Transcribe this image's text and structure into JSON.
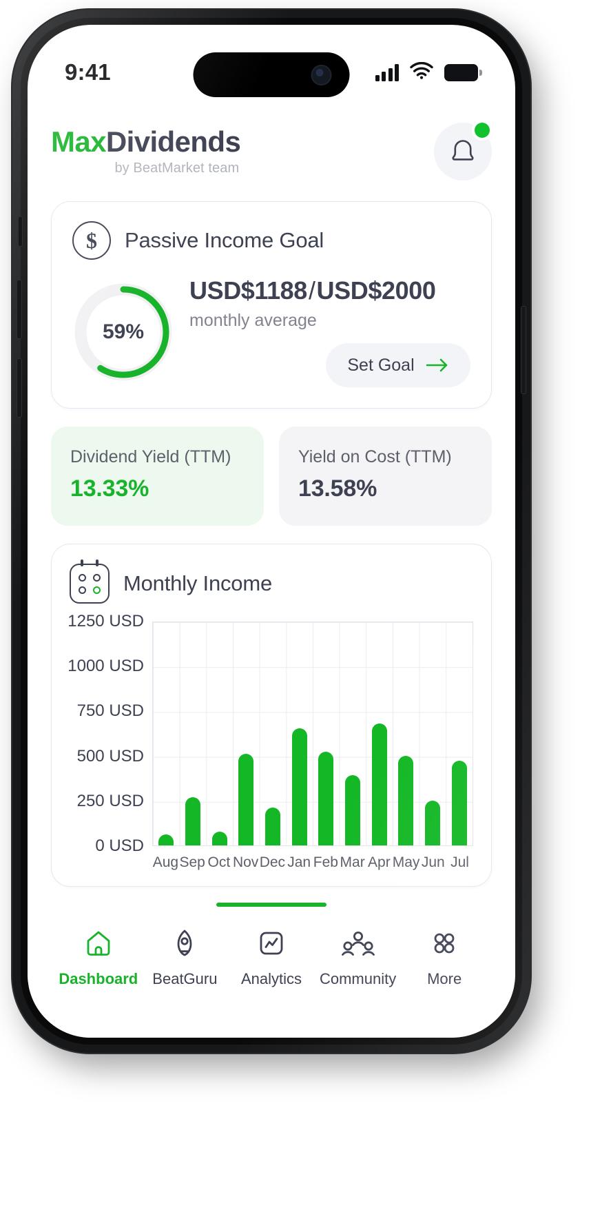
{
  "status_bar": {
    "time": "9:41",
    "signal_icon": "cellular-signal-icon",
    "wifi_icon": "wifi-icon",
    "battery_icon": "battery-icon"
  },
  "app_bar": {
    "brand_first": "Max",
    "brand_second": "Dividends",
    "brand_subtitle": "by BeatMarket team",
    "notification_icon": "bell-icon",
    "notification_badge": ""
  },
  "goal_card": {
    "icon": "dollar-circle-icon",
    "title": "Passive Income Goal",
    "percent_label": "59%",
    "percent_value": 59,
    "current_amount": "USD$1188",
    "separator": "/",
    "target_amount": "USD$2000",
    "subtitle": "monthly average",
    "set_goal_label": "Set Goal",
    "set_goal_arrow_icon": "arrow-right-icon"
  },
  "metrics": [
    {
      "label": "Dividend Yield (TTM)",
      "value": "13.33%",
      "style": "green"
    },
    {
      "label": "Yield on Cost (TTM)",
      "value": "13.58%",
      "style": "grey"
    }
  ],
  "chart_card": {
    "icon": "calendar-dots-icon",
    "title": "Monthly Income"
  },
  "chart_data": {
    "type": "bar",
    "title": "Monthly Income",
    "xlabel": "",
    "ylabel": "",
    "categories": [
      "Aug",
      "Sep",
      "Oct",
      "Nov",
      "Dec",
      "Jan",
      "Feb",
      "Mar",
      "Apr",
      "May",
      "Jun",
      "Jul"
    ],
    "values": [
      60,
      270,
      75,
      510,
      210,
      650,
      520,
      390,
      680,
      500,
      250,
      470
    ],
    "tick_labels": [
      "1250 USD",
      "1000 USD",
      "750 USD",
      "500 USD",
      "250 USD",
      "0 USD"
    ],
    "ticks": [
      1250,
      1000,
      750,
      500,
      250,
      0
    ],
    "ylim": [
      0,
      1250
    ],
    "unit": "USD",
    "grid": true,
    "legend": "none",
    "bar_color": "#14b826"
  },
  "tab_bar": {
    "items": [
      {
        "label": "Dashboard",
        "icon": "home-icon",
        "active": true
      },
      {
        "label": "BeatGuru",
        "icon": "rocket-icon",
        "active": false
      },
      {
        "label": "Analytics",
        "icon": "chart-square-icon",
        "active": false
      },
      {
        "label": "Community",
        "icon": "people-icon",
        "active": false
      },
      {
        "label": "More",
        "icon": "grid-dots-icon",
        "active": false
      }
    ]
  },
  "colors": {
    "accent_green": "#18b32b",
    "bar_green": "#14b826",
    "navy": "#3e4152",
    "muted": "#81848f",
    "card_green_bg": "#edf8ef",
    "card_grey_bg": "#f4f4f6"
  }
}
